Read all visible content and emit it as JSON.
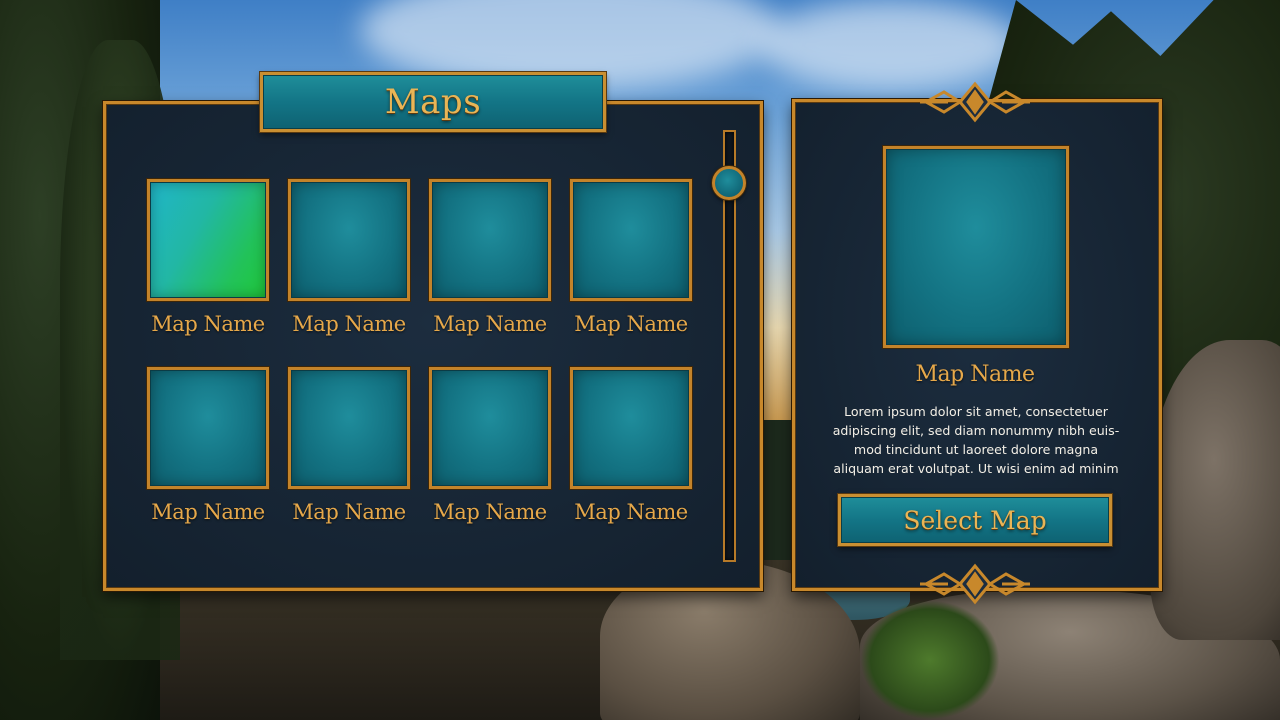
{
  "maps_panel": {
    "title": "Maps",
    "tiles": [
      {
        "name": "Map Name",
        "selected": true
      },
      {
        "name": "Map Name",
        "selected": false
      },
      {
        "name": "Map Name",
        "selected": false
      },
      {
        "name": "Map Name",
        "selected": false
      },
      {
        "name": "Map Name",
        "selected": false
      },
      {
        "name": "Map Name",
        "selected": false
      },
      {
        "name": "Map Name",
        "selected": false
      },
      {
        "name": "Map Name",
        "selected": false
      }
    ],
    "scroll_position": 0.0
  },
  "detail_panel": {
    "map_name": "Map Name",
    "description": "Lorem ipsum dolor sit amet, consectetuer adipiscing elit, sed diam nonummy nibh euis-mod tincidunt ut laoreet dolore magna aliquam erat volutpat. Ut wisi enim ad minim",
    "description_lines": [
      "Lorem ipsum dolor sit amet, consectetuer",
      "adipiscing elit, sed diam nonummy nibh euis-",
      "mod tincidunt ut laoreet dolore magna",
      "aliquam erat volutpat. Ut wisi enim ad minim"
    ],
    "select_label": "Select Map"
  },
  "colors": {
    "gold": "#c8882b",
    "text_gold": "#e6a84a",
    "teal": "#137586",
    "panel": "#1c2d3f",
    "selected_green": "#22c25a"
  }
}
